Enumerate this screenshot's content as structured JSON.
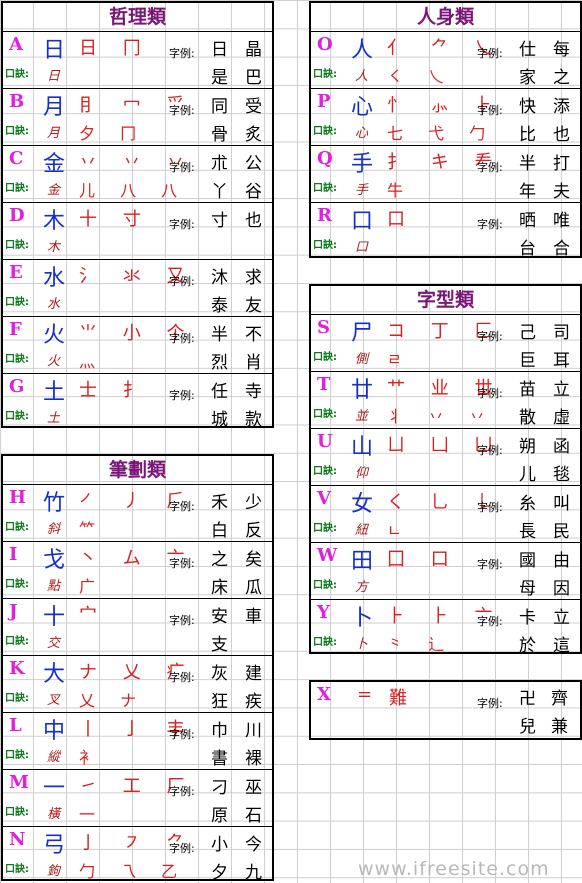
{
  "panels": {
    "philosophy": {
      "title": "哲理類",
      "rows": [
        {
          "letter": "A",
          "key": "日",
          "kj": "日",
          "forms": "日 冂",
          "forms2": "",
          "ex_label": "字例:",
          "ex": [
            "日",
            "晶",
            "是",
            "巴"
          ]
        },
        {
          "letter": "B",
          "key": "月",
          "kj": "月",
          "forms": "⺝ ⼍ ⺤",
          "forms2": "夕 冂",
          "ex_label": "字例:",
          "ex": [
            "同",
            "受",
            "骨",
            "炙"
          ]
        },
        {
          "letter": "C",
          "key": "金",
          "kj": "金",
          "forms": "丷 丷 丷",
          "forms2": "儿 八 八",
          "ex_label": "字例:",
          "ex": [
            "朮",
            "公",
            "丫",
            "谷"
          ]
        },
        {
          "letter": "D",
          "key": "木",
          "kj": "木",
          "forms": "十 寸",
          "forms2": "",
          "ex_label": "字例:",
          "ex": [
            "寸",
            "也",
            "",
            ""
          ]
        },
        {
          "letter": "E",
          "key": "水",
          "kj": "水",
          "forms": "氵 氺 又",
          "forms2": "",
          "ex_label": "字例:",
          "ex": [
            "沐",
            "求",
            "泰",
            "友"
          ]
        },
        {
          "letter": "F",
          "key": "火",
          "kj": "火",
          "forms": "⺌ 小 个",
          "forms2": "灬",
          "ex_label": "字例:",
          "ex": [
            "半",
            "不",
            "烈",
            "肖"
          ]
        },
        {
          "letter": "G",
          "key": "土",
          "kj": "土",
          "forms": "士 扌",
          "forms2": "",
          "ex_label": "字例:",
          "ex": [
            "任",
            "寺",
            "城",
            "款"
          ]
        }
      ]
    },
    "strokes": {
      "title": "筆劃類",
      "rows": [
        {
          "letter": "H",
          "key": "竹",
          "kj": "斜",
          "forms": "㇒ 丿 ⺁",
          "forms2": "⺮",
          "ex_label": "字例:",
          "ex": [
            "禾",
            "少",
            "白",
            "反"
          ]
        },
        {
          "letter": "I",
          "key": "戈",
          "kj": "點",
          "forms": "丶 ム 亠",
          "forms2": "广",
          "ex_label": "字例:",
          "ex": [
            "之",
            "矣",
            "床",
            "瓜"
          ]
        },
        {
          "letter": "J",
          "key": "十",
          "kj": "交",
          "forms": "宀",
          "forms2": "",
          "ex_label": "字例:",
          "ex": [
            "安",
            "車",
            "支",
            ""
          ]
        },
        {
          "letter": "K",
          "key": "大",
          "kj": "叉",
          "forms": "ナ 乂 疒",
          "forms2": "乂 ナ",
          "ex_label": "字例:",
          "ex": [
            "灰",
            "建",
            "狂",
            "疾"
          ]
        },
        {
          "letter": "L",
          "key": "中",
          "kj": "縱",
          "forms": "丨 亅 丰",
          "forms2": "衤",
          "ex_label": "字例:",
          "ex": [
            "巾",
            "川",
            "書",
            "裸"
          ]
        },
        {
          "letter": "M",
          "key": "一",
          "kj": "橫",
          "forms": "㇀ 工 厂",
          "forms2": "一",
          "ex_label": "字例:",
          "ex": [
            "刁",
            "巫",
            "原",
            "石"
          ]
        },
        {
          "letter": "N",
          "key": "弓",
          "kj": "鉤",
          "forms": "亅 ㇇ ⺈",
          "forms2": "勹 乁 乙",
          "ex_label": "字例:",
          "ex": [
            "小",
            "今",
            "夕",
            "九"
          ]
        }
      ]
    },
    "body": {
      "title": "人身類",
      "rows": [
        {
          "letter": "O",
          "key": "人",
          "kj": "人",
          "forms": "亻 ⺈ 乀",
          "forms2": "㇛ 乀",
          "ex_label": "字例:",
          "ex": [
            "仕",
            "每",
            "家",
            "之"
          ]
        },
        {
          "letter": "P",
          "key": "心",
          "kj": "心",
          "forms": "忄 ⺗ ⺊",
          "forms2": "七 弋 勹",
          "ex_label": "字例:",
          "ex": [
            "快",
            "添",
            "比",
            "也"
          ]
        },
        {
          "letter": "Q",
          "key": "手",
          "kj": "手",
          "forms": "扌 キ 龵",
          "forms2": "牛",
          "ex_label": "字例:",
          "ex": [
            "半",
            "打",
            "年",
            "夫"
          ]
        },
        {
          "letter": "R",
          "key": "口",
          "kj": "口",
          "forms": "口",
          "forms2": "",
          "ex_label": "字例:",
          "ex": [
            "晒",
            "唯",
            "台",
            "合"
          ]
        }
      ]
    },
    "shape": {
      "title": "字型類",
      "rows": [
        {
          "letter": "S",
          "key": "尸",
          "kj": "側",
          "forms": "コ 丁 匚",
          "forms2": "ㄹ",
          "ex_label": "字例:",
          "ex": [
            "己",
            "司",
            "巨",
            "耳"
          ]
        },
        {
          "letter": "T",
          "key": "廿",
          "kj": "並",
          "forms": "艹 业 丗",
          "forms2": "丬 丷 丷",
          "ex_label": "字例:",
          "ex": [
            "苗",
            "立",
            "散",
            "虛"
          ]
        },
        {
          "letter": "U",
          "key": "山",
          "kj": "仰",
          "forms": "ㄩ 凵 凵",
          "forms2": "",
          "ex_label": "字例:",
          "ex": [
            "朔",
            "函",
            "儿",
            "毯"
          ]
        },
        {
          "letter": "V",
          "key": "女",
          "kj": "紐",
          "forms": "く 乚 𠄌",
          "forms2": "ㄴ",
          "ex_label": "字例:",
          "ex": [
            "糸",
            "叫",
            "長",
            "民"
          ]
        },
        {
          "letter": "W",
          "key": "田",
          "kj": "方",
          "forms": "囗 口",
          "forms2": "",
          "ex_label": "字例:",
          "ex": [
            "國",
            "由",
            "母",
            "因"
          ]
        },
        {
          "letter": "Y",
          "key": "卜",
          "kj": "卜",
          "forms": "⺊ ⺊ 亠",
          "forms2": "⺀ ⻌",
          "ex_label": "字例:",
          "ex": [
            "卡",
            "立",
            "於",
            "這"
          ]
        }
      ]
    },
    "x": {
      "letter": "X",
      "key": "=",
      "forms": "難",
      "ex_label": "字例:",
      "ex": [
        "卍",
        "齊",
        "兒",
        "兼"
      ]
    }
  },
  "kj_label": "口訣:",
  "watermark": "www.ifreesite.com",
  "colors": {
    "letter": "#e01fe0",
    "key": "#1530c8",
    "form": "#d82020",
    "kj_label": "#0a7a1a",
    "title": "#7b1678"
  }
}
